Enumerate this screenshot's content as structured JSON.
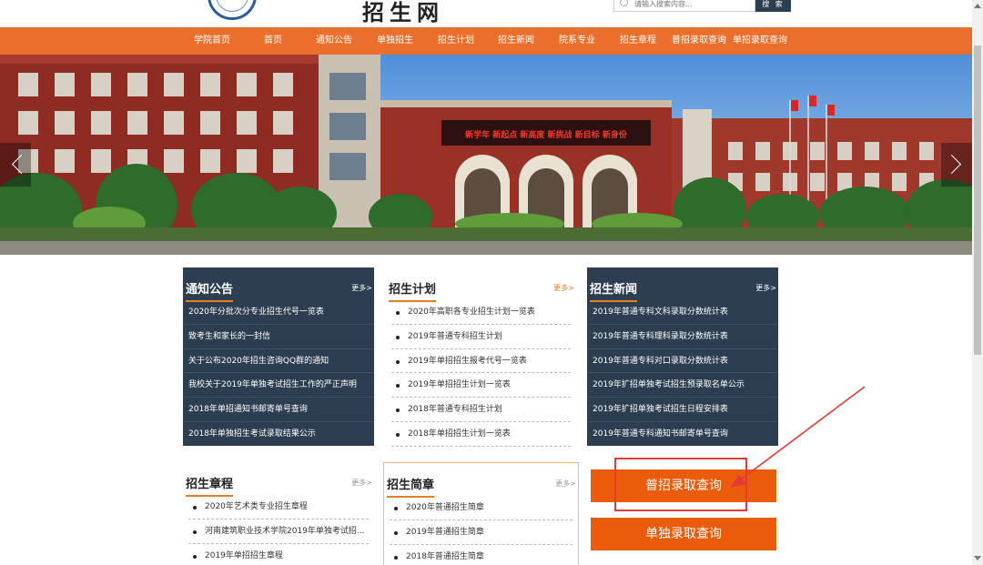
{
  "header": {
    "site_title": "招生网",
    "search_placeholder": "请输入搜索内容...",
    "search_button": "搜 索"
  },
  "nav": {
    "items": [
      "学院首页",
      "首页",
      "通知公告",
      "单独招生",
      "招生计划",
      "招生新闻",
      "院系专业",
      "招生章程",
      "普招录取查询",
      "单招录取查询"
    ]
  },
  "banner": {
    "sign_text": "新学年 新起点 新高度 新挑战 新目标 新身份"
  },
  "notices": {
    "title": "通知公告",
    "more": "更多>",
    "items": [
      "2020年分批次分专业招生代号一览表",
      "致考生和家长的一封信",
      "关于公布2020年招生咨询QQ群的通知",
      "我校关于2019年单独考试招生工作的严正声明",
      "2018年单招通知书邮寄单号查询",
      "2018年单独招生考试录取结果公示"
    ]
  },
  "plan": {
    "title": "招生计划",
    "more": "更多>",
    "items": [
      "2020年高职各专业招生计划一览表",
      "2019年普通专科招生计划",
      "2019年单招招生报考代号一览表",
      "2019年单招招生计划一览表",
      "2018年普通专科招生计划",
      "2018年单招招生计划一览表"
    ]
  },
  "news": {
    "title": "招生新闻",
    "more": "更多>",
    "items": [
      "2019年普通专科文科录取分数统计表",
      "2019年普通专科理科录取分数统计表",
      "2019年普通专科对口录取分数统计表",
      "2019年扩招单独考试招生预录取名单公示",
      "2019年扩招单独考试招生日程安排表",
      "2019年普通专科通知书邮寄单号查询"
    ]
  },
  "charter": {
    "title": "招生章程",
    "more": "更多>",
    "items": [
      "2020年艺术类专业招生章程",
      "河南建筑职业技术学院2019年单独考试招...",
      "2019年单招招生章程"
    ]
  },
  "brochure": {
    "title": "招生简章",
    "more": "更多>",
    "items": [
      "2020年普通招生简章",
      "2019年普通招生简章",
      "2018年普通招生简章"
    ]
  },
  "buttons": {
    "general_query": "普招录取查询",
    "single_query": "单独录取查询"
  },
  "colors": {
    "nav_orange": "#ea6f2d",
    "button_orange": "#ea5b0c",
    "panel_dark": "#2c3e50",
    "annotation_red": "#e53935"
  }
}
